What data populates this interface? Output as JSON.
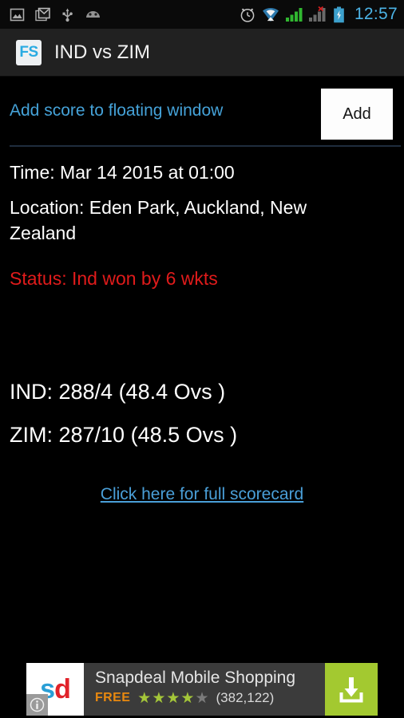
{
  "status_bar": {
    "left_icons": [
      "screenshot-icon",
      "gmail-icon",
      "usb-icon",
      "android-debug-icon"
    ],
    "right_icons": [
      "alarm-icon",
      "wifi-icon",
      "signal-bars-icon",
      "signal-bars-no-service-icon",
      "battery-charging-icon"
    ],
    "clock": "12:57",
    "clock_color": "#4cb4e7"
  },
  "action_bar": {
    "app_icon_text": "FS",
    "app_icon_color": "#29abe2",
    "title": "IND vs ZIM"
  },
  "floating_window": {
    "label": "Add score to floating window",
    "label_color": "#45a2d8",
    "add_label": "Add"
  },
  "details": {
    "time": "Time: Mar 14 2015 at 01:00",
    "location": "Location: Eden Park, Auckland, New Zealand",
    "status": "Status: Ind won by 6 wkts",
    "status_color": "#e01b1b"
  },
  "scores": [
    "IND: 288/4 (48.4 Ovs )",
    "ZIM: 287/10 (48.5 Ovs )"
  ],
  "scorecard": {
    "link_text": "Click here for full scorecard",
    "link_color": "#4a9fd8"
  },
  "ad": {
    "logo_s": "s",
    "logo_d": "d",
    "info_badge_icon": "info-icon",
    "title": "Snapdeal Mobile Shopping",
    "price": "FREE",
    "price_color": "#e8880f",
    "rating": 4,
    "rating_max": 5,
    "rating_count": "(382,122)",
    "star_on_color": "#a4c639",
    "star_off_color": "#7b7b7b",
    "cta_icon": "download-icon",
    "cta_color": "#a3c930"
  }
}
